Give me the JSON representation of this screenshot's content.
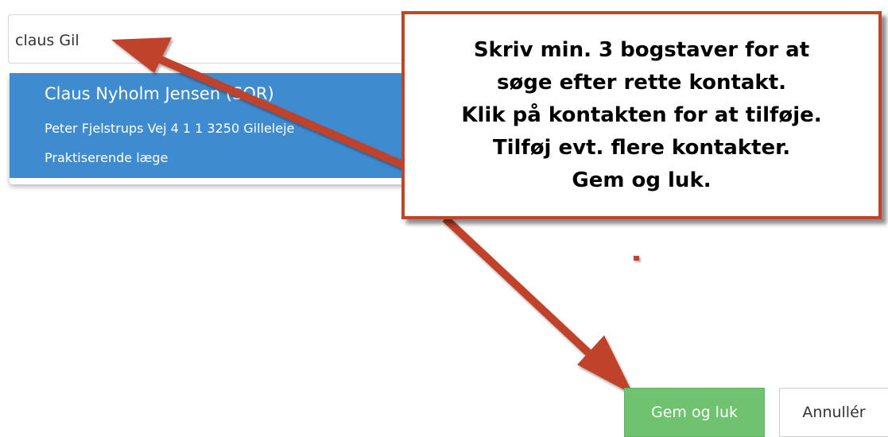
{
  "search": {
    "value": "claus Gil"
  },
  "results": [
    {
      "name": "Claus Nyholm Jensen (SOR)",
      "address": "Peter Fjelstrups Vej 4 1 1 3250 Gilleleje",
      "role": "Praktiserende læge"
    }
  ],
  "callout": {
    "lines": [
      "Skriv min. 3 bogstaver for at",
      "søge efter rette kontakt.",
      "Klik på kontakten for at tilføje.",
      "Tilføj evt. flere kontakter.",
      "Gem og luk."
    ]
  },
  "buttons": {
    "save_label": "Gem og luk",
    "cancel_label": "Annullér"
  },
  "colors": {
    "highlight": "#3f8bd0",
    "annotation": "#c0432a",
    "save_button": "#6fc26f"
  }
}
